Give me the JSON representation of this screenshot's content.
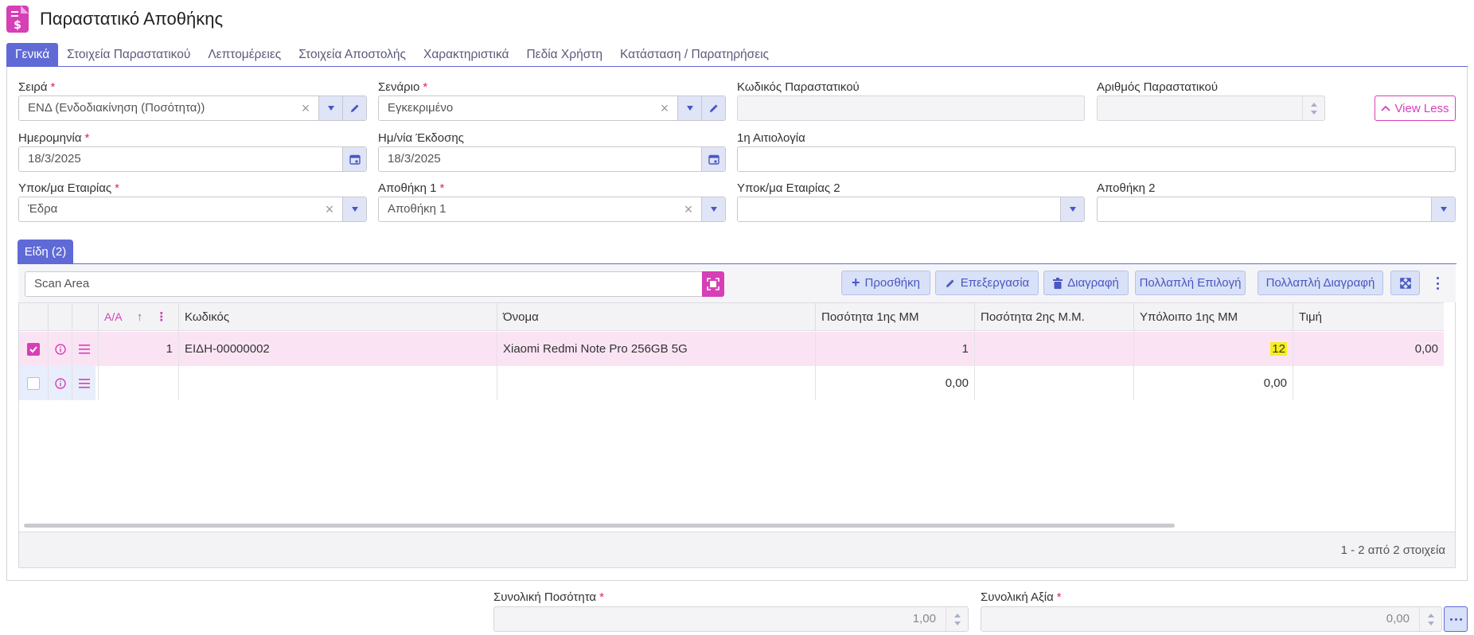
{
  "page": {
    "title": "Παραστατικό Αποθήκης"
  },
  "tabs": [
    {
      "label": "Γενικά",
      "active": true
    },
    {
      "label": "Στοιχεία Παραστατικού"
    },
    {
      "label": "Λεπτομέρειες"
    },
    {
      "label": "Στοιχεία Αποστολής"
    },
    {
      "label": "Χαρακτηριστικά"
    },
    {
      "label": "Πεδία Χρήστη"
    },
    {
      "label": "Κατάσταση / Παρατηρήσεις"
    }
  ],
  "form": {
    "series": {
      "label": "Σειρά",
      "value": "ΕΝΔ (Ενδοδιακίνηση (Ποσότητα))"
    },
    "scenario": {
      "label": "Σενάριο",
      "value": "Εγκεκριμένο"
    },
    "doc_code": {
      "label": "Κωδικός Παραστατικού",
      "value": ""
    },
    "doc_number": {
      "label": "Αριθμός Παραστατικού",
      "value": ""
    },
    "view_less": "View Less",
    "date": {
      "label": "Ημερομηνία",
      "value": "18/3/2025"
    },
    "issue_date": {
      "label": "Ημ/νία Έκδοσης",
      "value": "18/3/2025"
    },
    "reason": {
      "label": "1η Αιτιολογία",
      "value": ""
    },
    "branch": {
      "label": "Υποκ/μα Εταιρίας",
      "value": "Έδρα"
    },
    "warehouse1": {
      "label": "Αποθήκη 1",
      "value": "Αποθήκη 1"
    },
    "branch2": {
      "label": "Υποκ/μα Εταιρίας 2",
      "value": ""
    },
    "warehouse2": {
      "label": "Αποθήκη 2",
      "value": ""
    }
  },
  "items": {
    "tab_label": "Είδη (2)",
    "scan_placeholder": "Scan Area",
    "toolbar": {
      "add": "Προσθήκη",
      "edit": "Επεξεργασία",
      "delete": "Διαγραφή",
      "multi_select": "Πολλαπλή Επιλογή",
      "multi_delete": "Πολλαπλή Διαγραφή"
    },
    "columns": {
      "aa": "Α/Α",
      "code": "Κωδικός",
      "name": "Όνομα",
      "qty1": "Ποσότητα 1ης ΜΜ",
      "qty2": "Ποσότητα 2ης Μ.Μ.",
      "balance": "Υπόλοιπο 1ης ΜΜ",
      "price": "Τιμή"
    },
    "rows": [
      {
        "aa": "1",
        "code": "ΕΙΔΗ-00000002",
        "name": "Xiaomi Redmi Note Pro 256GB 5G",
        "qty1": "1",
        "qty2": "",
        "balance": "12",
        "price": "0,00",
        "checked": true
      },
      {
        "aa": "",
        "code": "",
        "name": "",
        "qty1": "0,00",
        "qty2": "",
        "balance": "0,00",
        "price": "",
        "checked": false
      }
    ],
    "pager": "1 - 2 από 2 στοιχεία"
  },
  "totals": {
    "total_qty": {
      "label": "Συνολική Ποσότητα",
      "value": "1,00"
    },
    "total_value": {
      "label": "Συνολική Αξία",
      "value": "0,00"
    }
  },
  "colors": {
    "accent": "#5f6ad6",
    "brand": "#d63fb6",
    "highlight": "#f7ee1e"
  }
}
